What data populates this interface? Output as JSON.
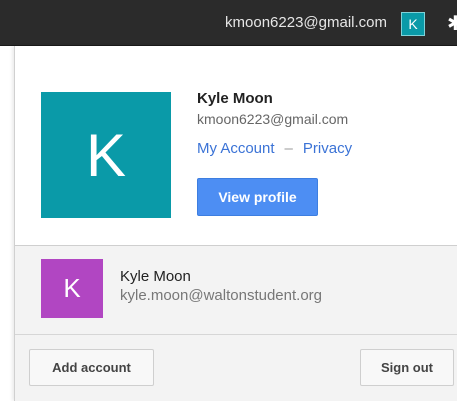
{
  "topbar": {
    "email": "kmoon6223@gmail.com",
    "avatar_letter": "K",
    "gear_icon": "gear-icon"
  },
  "primary_account": {
    "avatar_letter": "K",
    "avatar_color": "#0a9aa8",
    "name": "Kyle Moon",
    "email": "kmoon6223@gmail.com",
    "my_account_label": "My Account",
    "separator": "–",
    "privacy_label": "Privacy",
    "view_profile_label": "View profile"
  },
  "secondary_account": {
    "avatar_letter": "K",
    "avatar_color": "#b146c2",
    "name": "Kyle Moon",
    "email": "kyle.moon@waltonstudent.org"
  },
  "footer": {
    "add_account_label": "Add account",
    "sign_out_label": "Sign out"
  },
  "colors": {
    "accent_button": "#4d8ef3",
    "link": "#3b73d6",
    "topbar_bg": "#2b2b2b"
  }
}
